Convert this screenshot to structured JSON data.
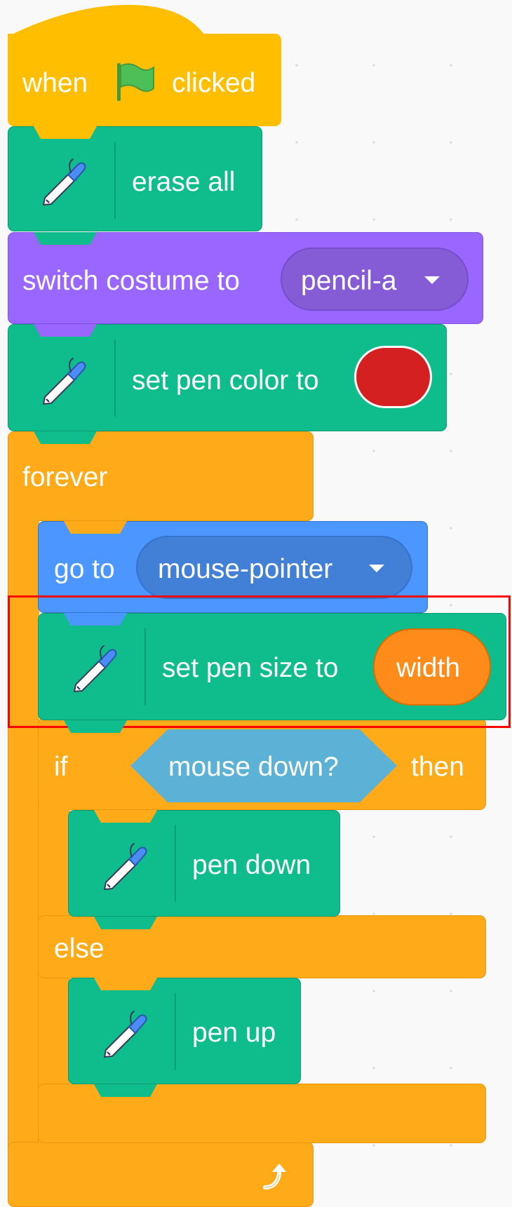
{
  "hat": {
    "when": "when",
    "clicked": "clicked"
  },
  "blocks": {
    "erase_all": "erase all",
    "switch_costume": {
      "label": "switch costume to",
      "value": "pencil-a"
    },
    "set_pen_color": {
      "label": "set pen color to",
      "color": "#d42020"
    },
    "forever": "forever",
    "go_to": {
      "label": "go to",
      "value": "mouse-pointer"
    },
    "set_pen_size": {
      "label": "set pen size to",
      "value": "width"
    },
    "if_else": {
      "if": "if",
      "condition": "mouse down?",
      "then": "then",
      "else": "else"
    },
    "pen_down": "pen down",
    "pen_up": "pen up"
  },
  "icons": {
    "pen": "pen-icon",
    "flag": "green-flag-icon",
    "loop": "loop-arrow-icon",
    "dropdown": "caret-down-icon"
  },
  "colors": {
    "events": "#ffbf00",
    "pen": "#0fbd8c",
    "looks": "#9966ff",
    "motion": "#4c97ff",
    "control": "#ffab19",
    "sensing": "#5cb1d6",
    "variable": "#ff8c1a",
    "highlight": "#ff0000"
  }
}
